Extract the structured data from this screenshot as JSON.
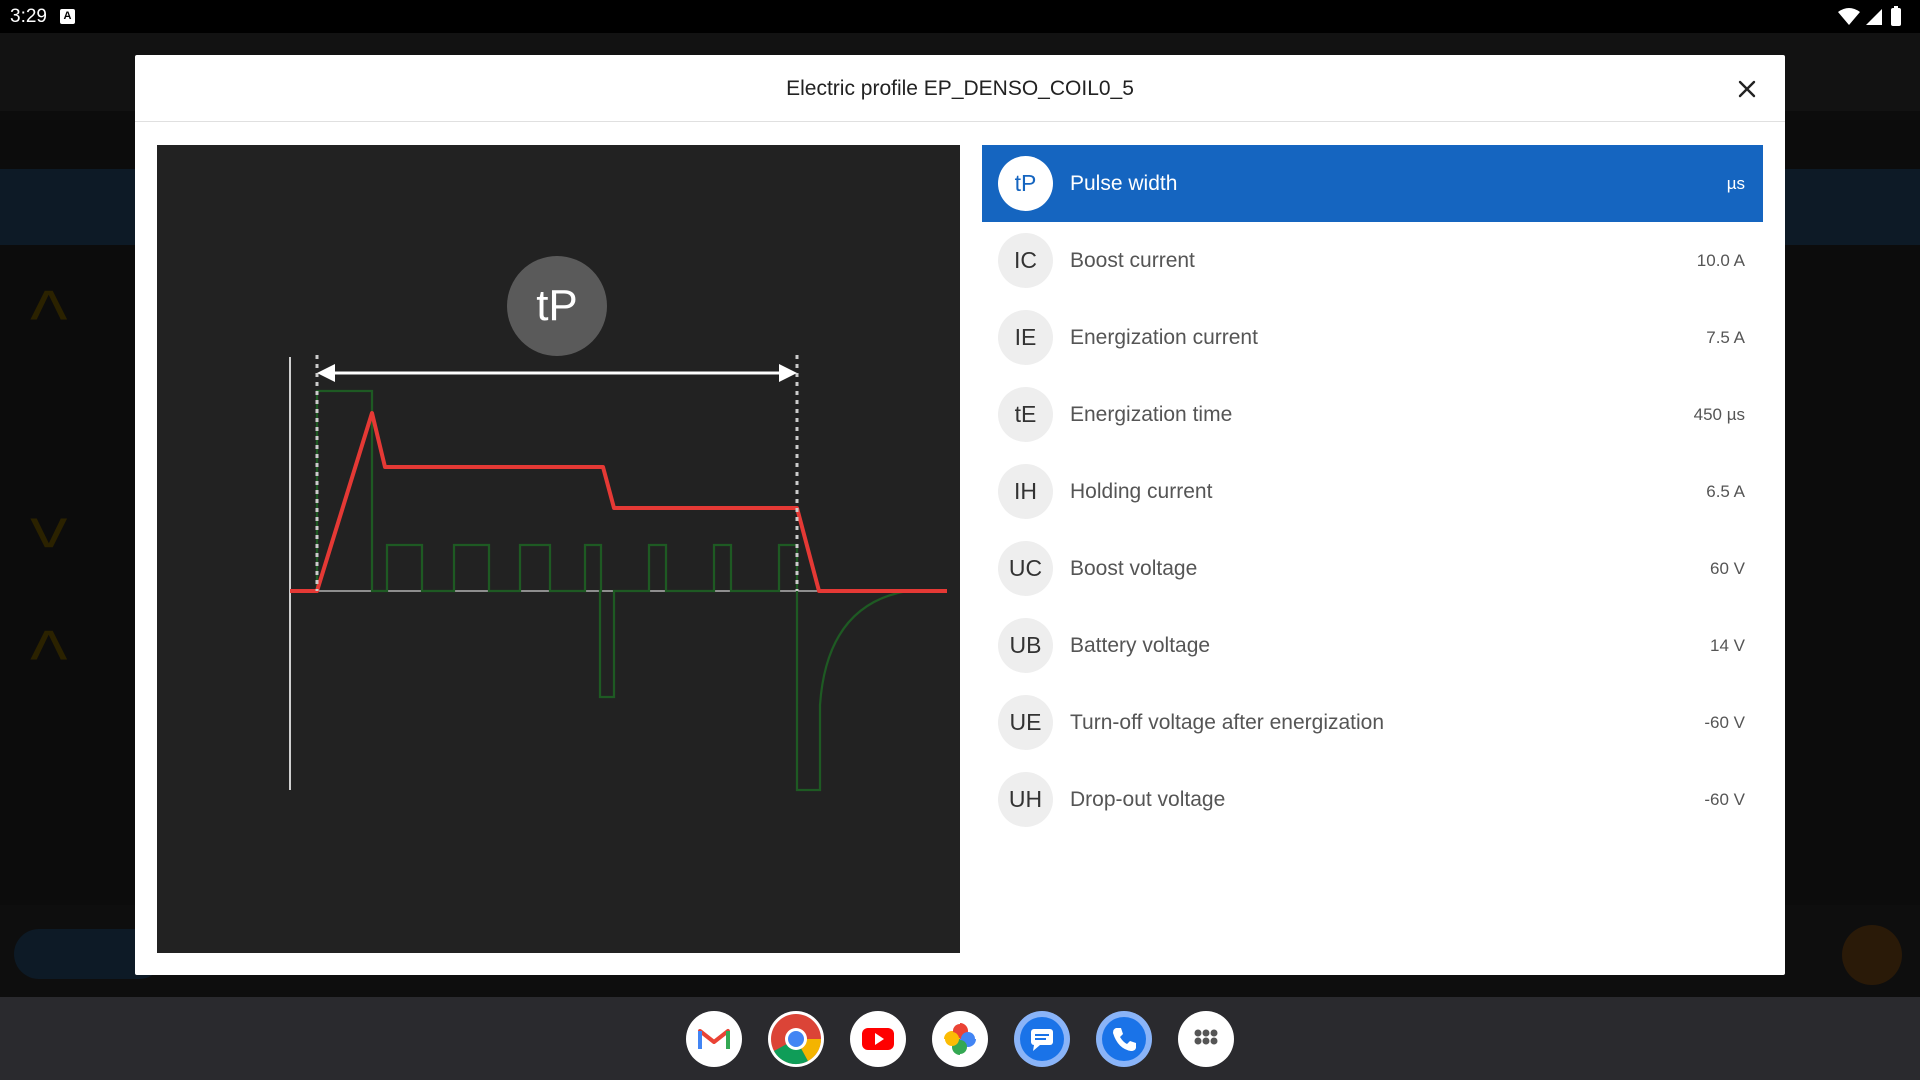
{
  "status_bar": {
    "time": "3:29",
    "notification_icon": "A"
  },
  "dialog": {
    "title": "Electric profile EP_DENSO_COIL0_5",
    "close_icon": "close-icon"
  },
  "diagram": {
    "marker_label": "tP",
    "colors": {
      "current": "#e53935",
      "voltage": "#1e5a23",
      "arrow": "#ffffff",
      "guides": "#cccccc",
      "marker_bg": "#5a5a5a"
    }
  },
  "parameters": [
    {
      "badge": "tP",
      "label": "Pulse width",
      "value": "µs",
      "selected": true
    },
    {
      "badge": "IC",
      "label": "Boost current",
      "value": "10.0 A",
      "selected": false
    },
    {
      "badge": "IE",
      "label": "Energization current",
      "value": "7.5 A",
      "selected": false
    },
    {
      "badge": "tE",
      "label": "Energization time",
      "value": "450 µs",
      "selected": false
    },
    {
      "badge": "IH",
      "label": "Holding current",
      "value": "6.5 A",
      "selected": false
    },
    {
      "badge": "UC",
      "label": "Boost voltage",
      "value": "60 V",
      "selected": false
    },
    {
      "badge": "UB",
      "label": "Battery voltage",
      "value": "14 V",
      "selected": false
    },
    {
      "badge": "UE",
      "label": "Turn-off voltage after energization",
      "value": "-60 V",
      "selected": false
    },
    {
      "badge": "UH",
      "label": "Drop-out voltage",
      "value": "-60 V",
      "selected": false
    }
  ],
  "accent_color": "#1565c0",
  "dock_apps": [
    "gmail-icon",
    "chrome-icon",
    "youtube-icon",
    "photos-icon",
    "messages-icon",
    "phone-icon",
    "app-drawer-icon"
  ]
}
